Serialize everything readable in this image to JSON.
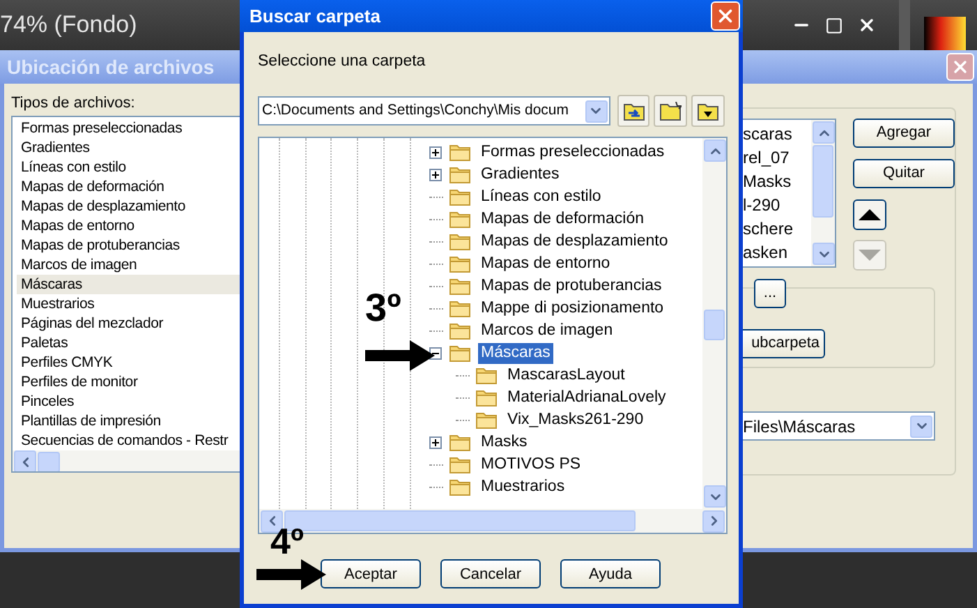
{
  "app_window": {
    "title": "74% (Fondo)"
  },
  "file_locations_dialog": {
    "title": "Ubicación de archivos",
    "file_types_label": "Tipos de archivos:",
    "file_types": [
      {
        "label": "Formas preseleccionadas",
        "selected": false
      },
      {
        "label": "Gradientes",
        "selected": false
      },
      {
        "label": "Líneas con estilo",
        "selected": false
      },
      {
        "label": "Mapas de deformación",
        "selected": false
      },
      {
        "label": "Mapas de desplazamiento",
        "selected": false
      },
      {
        "label": "Mapas de entorno",
        "selected": false
      },
      {
        "label": "Mapas de protuberancias",
        "selected": false
      },
      {
        "label": "Marcos de imagen",
        "selected": false
      },
      {
        "label": "Máscaras",
        "selected": true
      },
      {
        "label": "Muestrarios",
        "selected": false
      },
      {
        "label": "Páginas del mezclador",
        "selected": false
      },
      {
        "label": "Paletas",
        "selected": false
      },
      {
        "label": "Perfiles CMYK",
        "selected": false
      },
      {
        "label": "Perfiles de monitor",
        "selected": false
      },
      {
        "label": "Pinceles",
        "selected": false
      },
      {
        "label": "Plantillas de impresión",
        "selected": false
      },
      {
        "label": "Secuencias de comandos - Restr",
        "selected": false
      }
    ],
    "folders": [
      "scaras",
      "rel_07",
      "Masks",
      "l-290",
      "schere",
      "asken"
    ],
    "add_button": "Agregar",
    "remove_button": "Quitar",
    "browse_button": "...",
    "subfolder_button": "ubcarpeta",
    "save_folder": "Files\\Máscaras"
  },
  "browse_dialog": {
    "title": "Buscar carpeta",
    "prompt": "Seleccione una carpeta",
    "path": "C:\\Documents and Settings\\Conchy\\Mis docum",
    "tree": [
      {
        "label": "Formas preseleccionadas",
        "kind": "expandable",
        "expanded": false,
        "selected": false
      },
      {
        "label": "Gradientes",
        "kind": "expandable",
        "expanded": false,
        "selected": false
      },
      {
        "label": "Líneas con estilo",
        "kind": "leaf",
        "selected": false
      },
      {
        "label": "Mapas de deformación",
        "kind": "leaf",
        "selected": false
      },
      {
        "label": "Mapas de desplazamiento",
        "kind": "leaf",
        "selected": false
      },
      {
        "label": "Mapas de entorno",
        "kind": "leaf",
        "selected": false
      },
      {
        "label": "Mapas de protuberancias",
        "kind": "leaf",
        "selected": false
      },
      {
        "label": "Mappe di posizionamento",
        "kind": "leaf",
        "selected": false
      },
      {
        "label": "Marcos de imagen",
        "kind": "leaf",
        "selected": false
      },
      {
        "label": "Máscaras",
        "kind": "expandable",
        "expanded": true,
        "selected": true,
        "children": [
          {
            "label": "MascarasLayout",
            "kind": "leaf",
            "selected": false
          },
          {
            "label": "MaterialAdrianaLovely",
            "kind": "leaf",
            "selected": false
          },
          {
            "label": "Vix_Masks261-290",
            "kind": "leaf",
            "selected": false
          }
        ]
      },
      {
        "label": "Masks",
        "kind": "expandable",
        "expanded": false,
        "selected": false
      },
      {
        "label": "MOTIVOS PS",
        "kind": "leaf",
        "selected": false
      },
      {
        "label": "Muestrarios",
        "kind": "leaf",
        "selected": false
      }
    ],
    "buttons": [
      "Aceptar",
      "Cancelar",
      "Ayuda"
    ]
  },
  "annotations": [
    {
      "label": "3º"
    },
    {
      "label": "4º"
    }
  ]
}
